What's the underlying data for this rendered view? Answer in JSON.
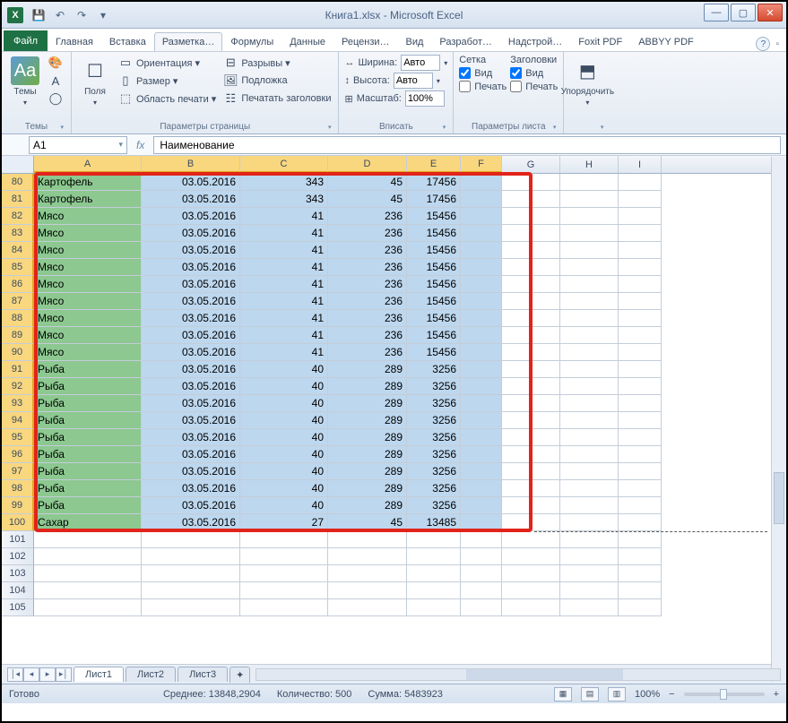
{
  "title": "Книга1.xlsx - Microsoft Excel",
  "qat": {
    "save": "💾",
    "undo": "↶",
    "redo": "↷"
  },
  "tabs": {
    "file": "Файл",
    "t": [
      "Главная",
      "Вставка",
      "Разметка…",
      "Формулы",
      "Данные",
      "Рецензи…",
      "Вид",
      "Разработ…",
      "Надстрой…",
      "Foxit PDF",
      "ABBYY PDF"
    ]
  },
  "ribbon": {
    "g1": {
      "label": "Темы",
      "themes": "Темы"
    },
    "g2": {
      "label": "Параметры страницы",
      "fields": "Поля",
      "orient": "Ориентация ▾",
      "size": "Размер ▾",
      "area": "Область печати ▾",
      "breaks": "Разрывы ▾",
      "bg": "Подложка",
      "titles": "Печатать заголовки"
    },
    "g3": {
      "label": "Вписать",
      "width": "Ширина:",
      "height": "Высота:",
      "scale": "Масштаб:",
      "auto": "Авто",
      "pct": "100%"
    },
    "g4": {
      "label": "Параметры листа",
      "grid": "Сетка",
      "headers": "Заголовки",
      "view": "Вид",
      "print": "Печать"
    },
    "g5": {
      "label": "",
      "arrange": "Упорядочить"
    }
  },
  "namebox": "A1",
  "formula": "Наименование",
  "cols": [
    "A",
    "B",
    "C",
    "D",
    "E",
    "F",
    "G",
    "H",
    "I"
  ],
  "selcols": [
    "A",
    "B",
    "C",
    "D",
    "E",
    "F"
  ],
  "rows": [
    {
      "n": 80,
      "a": "Картофель",
      "b": "03.05.2016",
      "c": "343",
      "d": "45",
      "e": "17456"
    },
    {
      "n": 81,
      "a": "Картофель",
      "b": "03.05.2016",
      "c": "343",
      "d": "45",
      "e": "17456"
    },
    {
      "n": 82,
      "a": "Мясо",
      "b": "03.05.2016",
      "c": "41",
      "d": "236",
      "e": "15456"
    },
    {
      "n": 83,
      "a": "Мясо",
      "b": "03.05.2016",
      "c": "41",
      "d": "236",
      "e": "15456"
    },
    {
      "n": 84,
      "a": "Мясо",
      "b": "03.05.2016",
      "c": "41",
      "d": "236",
      "e": "15456"
    },
    {
      "n": 85,
      "a": "Мясо",
      "b": "03.05.2016",
      "c": "41",
      "d": "236",
      "e": "15456"
    },
    {
      "n": 86,
      "a": "Мясо",
      "b": "03.05.2016",
      "c": "41",
      "d": "236",
      "e": "15456"
    },
    {
      "n": 87,
      "a": "Мясо",
      "b": "03.05.2016",
      "c": "41",
      "d": "236",
      "e": "15456"
    },
    {
      "n": 88,
      "a": "Мясо",
      "b": "03.05.2016",
      "c": "41",
      "d": "236",
      "e": "15456"
    },
    {
      "n": 89,
      "a": "Мясо",
      "b": "03.05.2016",
      "c": "41",
      "d": "236",
      "e": "15456"
    },
    {
      "n": 90,
      "a": "Мясо",
      "b": "03.05.2016",
      "c": "41",
      "d": "236",
      "e": "15456"
    },
    {
      "n": 91,
      "a": "Рыба",
      "b": "03.05.2016",
      "c": "40",
      "d": "289",
      "e": "3256"
    },
    {
      "n": 92,
      "a": "Рыба",
      "b": "03.05.2016",
      "c": "40",
      "d": "289",
      "e": "3256"
    },
    {
      "n": 93,
      "a": "Рыба",
      "b": "03.05.2016",
      "c": "40",
      "d": "289",
      "e": "3256"
    },
    {
      "n": 94,
      "a": "Рыба",
      "b": "03.05.2016",
      "c": "40",
      "d": "289",
      "e": "3256"
    },
    {
      "n": 95,
      "a": "Рыба",
      "b": "03.05.2016",
      "c": "40",
      "d": "289",
      "e": "3256"
    },
    {
      "n": 96,
      "a": "Рыба",
      "b": "03.05.2016",
      "c": "40",
      "d": "289",
      "e": "3256"
    },
    {
      "n": 97,
      "a": "Рыба",
      "b": "03.05.2016",
      "c": "40",
      "d": "289",
      "e": "3256"
    },
    {
      "n": 98,
      "a": "Рыба",
      "b": "03.05.2016",
      "c": "40",
      "d": "289",
      "e": "3256"
    },
    {
      "n": 99,
      "a": "Рыба",
      "b": "03.05.2016",
      "c": "40",
      "d": "289",
      "e": "3256"
    },
    {
      "n": 100,
      "a": "Сахар",
      "b": "03.05.2016",
      "c": "27",
      "d": "45",
      "e": "13485"
    }
  ],
  "emptyrows": [
    101,
    102,
    103,
    104,
    105
  ],
  "sheets": [
    "Лист1",
    "Лист2",
    "Лист3"
  ],
  "status": {
    "ready": "Готово",
    "avg": "Среднее: 13848,2904",
    "count": "Количество: 500",
    "sum": "Сумма: 5483923",
    "zoom": "100%"
  }
}
